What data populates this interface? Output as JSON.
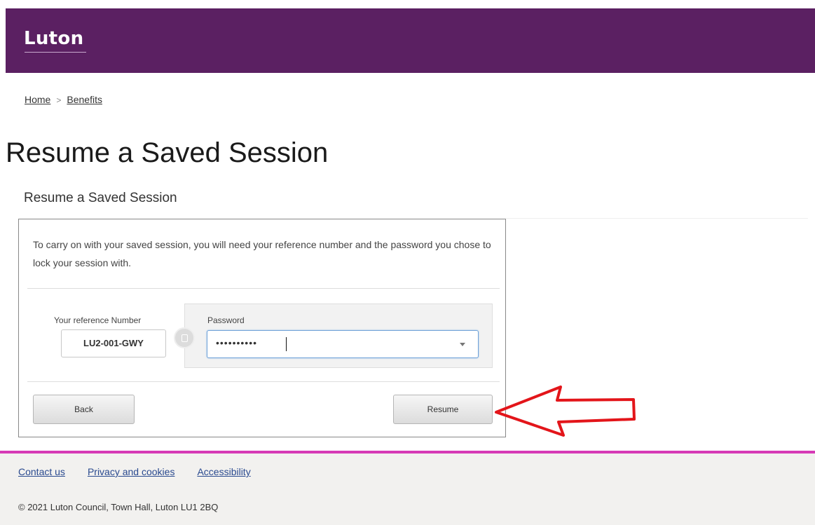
{
  "header": {
    "logo_text": "Luton"
  },
  "breadcrumb": {
    "home": "Home",
    "separator": ">",
    "current": "Benefits"
  },
  "page_title": "Resume a Saved Session",
  "section_title": "Resume a Saved Session",
  "panel": {
    "intro": "To carry on with your saved session, you will need your reference number and the password you chose to lock your session with.",
    "reference_label": "Your reference Number",
    "reference_value": "LU2-001-GWY",
    "password_label": "Password",
    "password_masked": "••••••••••",
    "back_label": "Back",
    "resume_label": "Resume"
  },
  "footer": {
    "links": [
      "Contact us",
      "Privacy and cookies",
      "Accessibility"
    ],
    "copyright": "© 2021 Luton Council, Town Hall, Luton LU1 2BQ"
  },
  "colors": {
    "header_bg": "#5b2062",
    "footer_accent": "#d63ab6",
    "annotation_arrow": "#e3151a",
    "link": "#2a4a8f"
  },
  "icons": {
    "connector": "lock-icon",
    "password_toggle": "dropdown-arrow-icon",
    "annotation": "red-arrow-icon"
  }
}
